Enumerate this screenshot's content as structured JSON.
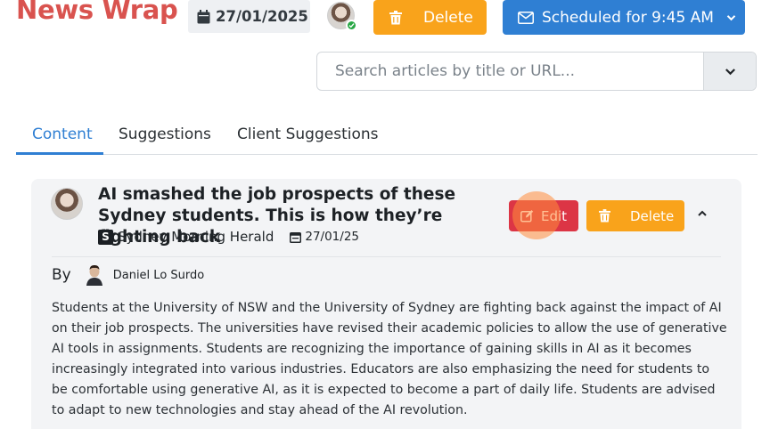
{
  "header": {
    "app_title": "News Wrap",
    "date": "27/01/2025",
    "delete_label": "Delete",
    "schedule_label": "Scheduled for 9:45 AM"
  },
  "search": {
    "placeholder": "Search articles by title or URL..."
  },
  "tabs": [
    {
      "label": "Content",
      "active": true
    },
    {
      "label": "Suggestions",
      "active": false
    },
    {
      "label": "Client Suggestions",
      "active": false
    }
  ],
  "article": {
    "title": "AI smashed the job prospects of these Sydney students. This is how they’re fighting back",
    "source": "Sydney Morning Herald",
    "source_logo_letter": "S",
    "date": "27/01/25",
    "edit_label": "Edit",
    "delete_label": "Delete",
    "by_label": "By",
    "author": "Daniel Lo Surdo",
    "summary": "Students at the University of NSW and the University of Sydney are fighting back against the impact of AI on their job prospects. The universities have revised their academic policies to allow the use of generative AI tools in assignments. Students are recognizing the importance of gaining skills in AI as it becomes increasingly integrated into various industries. Educators are also emphasizing the need for students to be comfortable using generative AI, as it is expected to become a part of daily life. Students are advised to adapt to new technologies and stay ahead of the AI revolution."
  },
  "colors": {
    "brand_red": "#d9534f",
    "warning_orange": "#f9a31b",
    "primary_blue": "#2f7fd3",
    "danger_red": "#dc3545",
    "online_green": "#28a745"
  },
  "icons": [
    "calendar-icon",
    "trash-icon",
    "envelope-icon",
    "chevron-down-icon",
    "edit-icon",
    "chevron-up-icon"
  ]
}
